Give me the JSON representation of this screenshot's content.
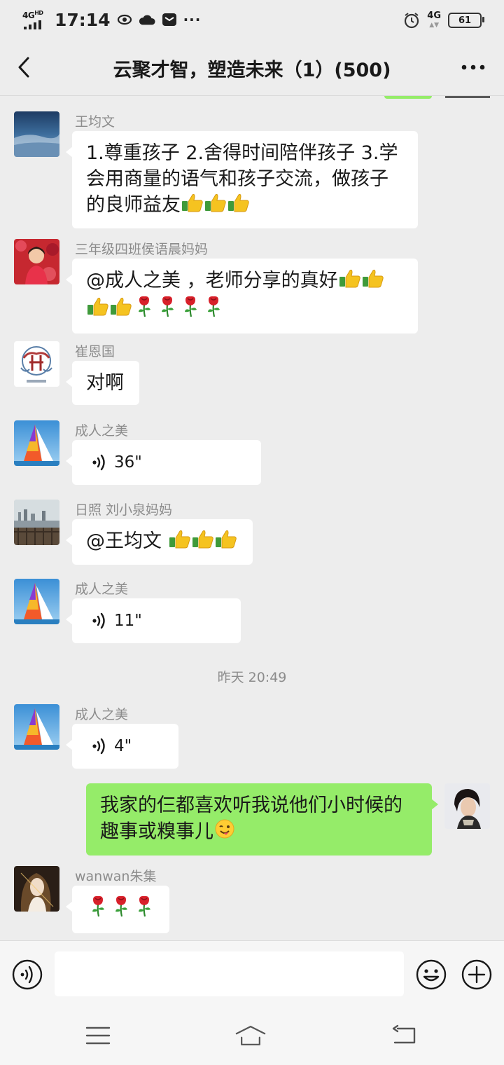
{
  "status_bar": {
    "network": "4G",
    "network_hd": "HD",
    "time": "17:14",
    "dots": "···",
    "network_right": "4G",
    "battery": "61"
  },
  "header": {
    "title": "云聚才智，塑造未来（1）(500)"
  },
  "messages": [
    {
      "sender": "王均文",
      "text": "1.尊重孩子 2.舍得时间陪伴孩子 3.学会用商量的语气和孩子交流，做孩子的良师益友",
      "emoji": [
        "thumbs-up",
        "thumbs-up",
        "thumbs-up"
      ]
    },
    {
      "sender": "三年级四班侯语晨妈妈",
      "text": "@成人之美 ，老师分享的真好",
      "emoji": [
        "thumbs-up",
        "thumbs-up",
        "thumbs-up",
        "thumbs-up",
        "rose",
        "rose",
        "rose",
        "rose"
      ]
    },
    {
      "sender": "崔恩国",
      "text": "对啊"
    },
    {
      "sender": "成人之美",
      "voice": "36\""
    },
    {
      "sender": "日照  刘小泉妈妈",
      "text": "@王均文 ",
      "emoji": [
        "thumbs-up",
        "thumbs-up",
        "thumbs-up"
      ]
    },
    {
      "sender": "成人之美",
      "voice": "11\""
    },
    {
      "timestamp": "昨天 20:49"
    },
    {
      "sender": "成人之美",
      "voice": "4\""
    },
    {
      "self": true,
      "text": "我家的仨都喜欢听我说他们小时候的趣事或糗事儿",
      "emoji": [
        "wink"
      ]
    },
    {
      "sender": "wanwan朱集",
      "emoji": [
        "rose",
        "rose",
        "rose"
      ]
    }
  ],
  "input_bar": {
    "voice_icon": "voice-icon",
    "emoji_icon": "smiley-icon",
    "plus_icon": "plus-icon",
    "text_value": ""
  },
  "nav_bar": {
    "icons": [
      "menu-icon",
      "home-icon",
      "back-icon"
    ]
  },
  "colors": {
    "background": "#ededed",
    "self_bubble": "#95ec69",
    "other_bubble": "#ffffff",
    "meta_text": "#8c8c8c"
  }
}
